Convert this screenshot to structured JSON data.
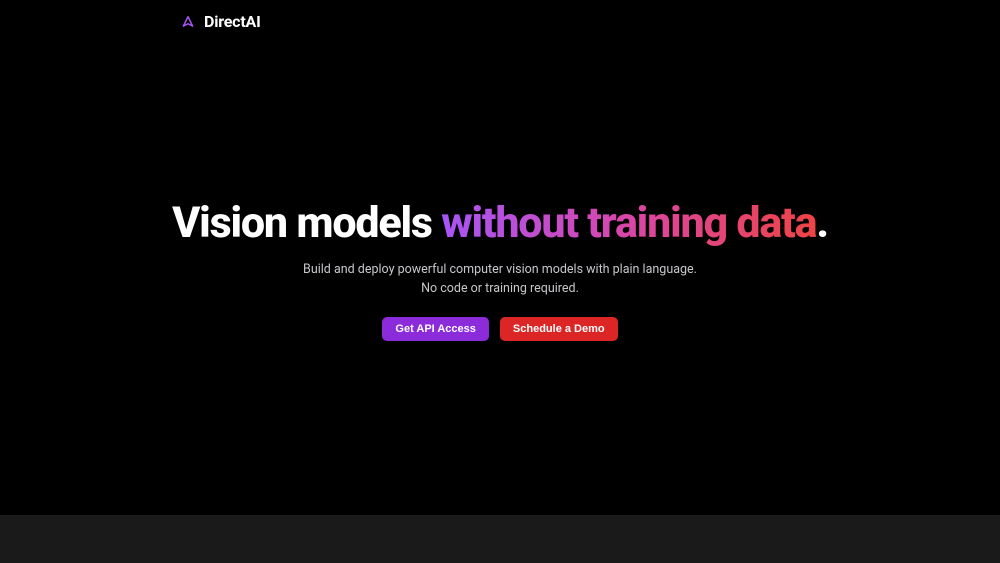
{
  "header": {
    "brand": "DirectAI"
  },
  "hero": {
    "title_plain": "Vision models ",
    "title_gradient": "without training data",
    "title_period": ".",
    "subtitle_line1": "Build and deploy powerful computer vision models with plain language.",
    "subtitle_line2": "No code or training required."
  },
  "cta": {
    "primary_label": "Get API Access",
    "secondary_label": "Schedule a Demo"
  },
  "colors": {
    "accent_purple": "#8b2bd9",
    "accent_red": "#dc2626",
    "gradient_start": "#a855f7",
    "gradient_end": "#ef4444"
  }
}
